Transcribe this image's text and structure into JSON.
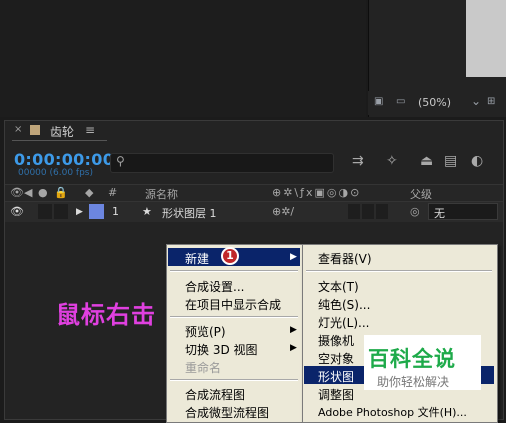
{
  "viewer": {
    "zoom": "(50%)",
    "zoom_arrow": "⌄"
  },
  "panel": {
    "close": "×",
    "title": "齿轮",
    "menu": "≡"
  },
  "timeline": {
    "timecode": "0:00:00:00",
    "fps": "00000 (6.00 fps)",
    "search_placeholder": "",
    "columns": {
      "num": "#",
      "source_name": "源名称",
      "parent": "父级"
    },
    "layer": {
      "index": "1",
      "name": "形状图层 1",
      "parent": "无"
    }
  },
  "context_menu": {
    "items": [
      "新建",
      "合成设置...",
      "在项目中显示合成",
      "预览(P)",
      "切换 3D 视图",
      "重命名",
      "合成流程图",
      "合成微型流程图"
    ],
    "disabled": [
      "重命名"
    ]
  },
  "submenu": {
    "items": [
      "查看器(V)",
      "文本(T)",
      "纯色(S)...",
      "灯光(L)...",
      "摄像机",
      "空对象",
      "形状图",
      "调整图",
      "Adobe Photoshop 文件(H)..."
    ]
  },
  "annotations": {
    "step": "1",
    "hint": "鼠标右击"
  },
  "watermark": {
    "title": "百科全说",
    "subtitle": "助你轻松解决"
  },
  "colors": {
    "timecode": "#3d9ae8",
    "highlight": "#0a246a",
    "layer_label": "#6c86e0",
    "annotation": "#e040e0",
    "watermark": "#1eaa4a"
  }
}
